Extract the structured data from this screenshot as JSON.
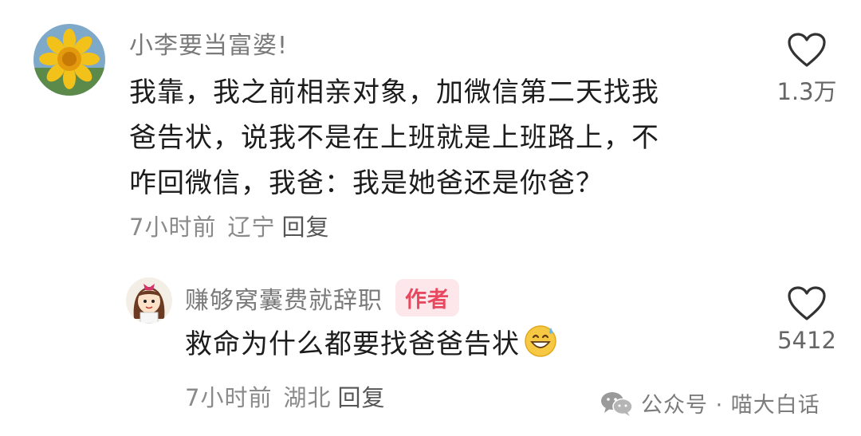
{
  "comments": [
    {
      "username": "小李要当富婆!",
      "text": "我靠，我之前相亲对象，加微信第二天找我爸告状，说我不是在上班就是上班路上，不咋回微信，我爸：我是她爸还是你爸？",
      "text_lines": [
        "我靠，我之前相亲对象，加微信第二天找我",
        "爸告状，说我不是在上班就是上班路上，不",
        "咋回微信，我爸：我是她爸还是你爸？"
      ],
      "time": "7小时前",
      "location": "辽宁",
      "reply_label": "回复",
      "like_count": "1.3万",
      "avatar_icon": "sunflower-avatar"
    }
  ],
  "reply": {
    "username": "赚够窝囊费就辞职",
    "badge": "作者",
    "text": "救命为什么都要找爸爸告状",
    "emoji_icon": "grinning-sweat-emoji",
    "time": "7小时前",
    "location": "湖北",
    "reply_label": "回复",
    "like_count": "5412",
    "avatar_icon": "cartoon-girl-avatar"
  },
  "watermark": {
    "text": "公众号 · 喵大白话",
    "icon": "wechat-icon"
  },
  "colors": {
    "badge_bg": "#fde7ea",
    "badge_text": "#e8495f",
    "meta": "#8a8a8a"
  }
}
